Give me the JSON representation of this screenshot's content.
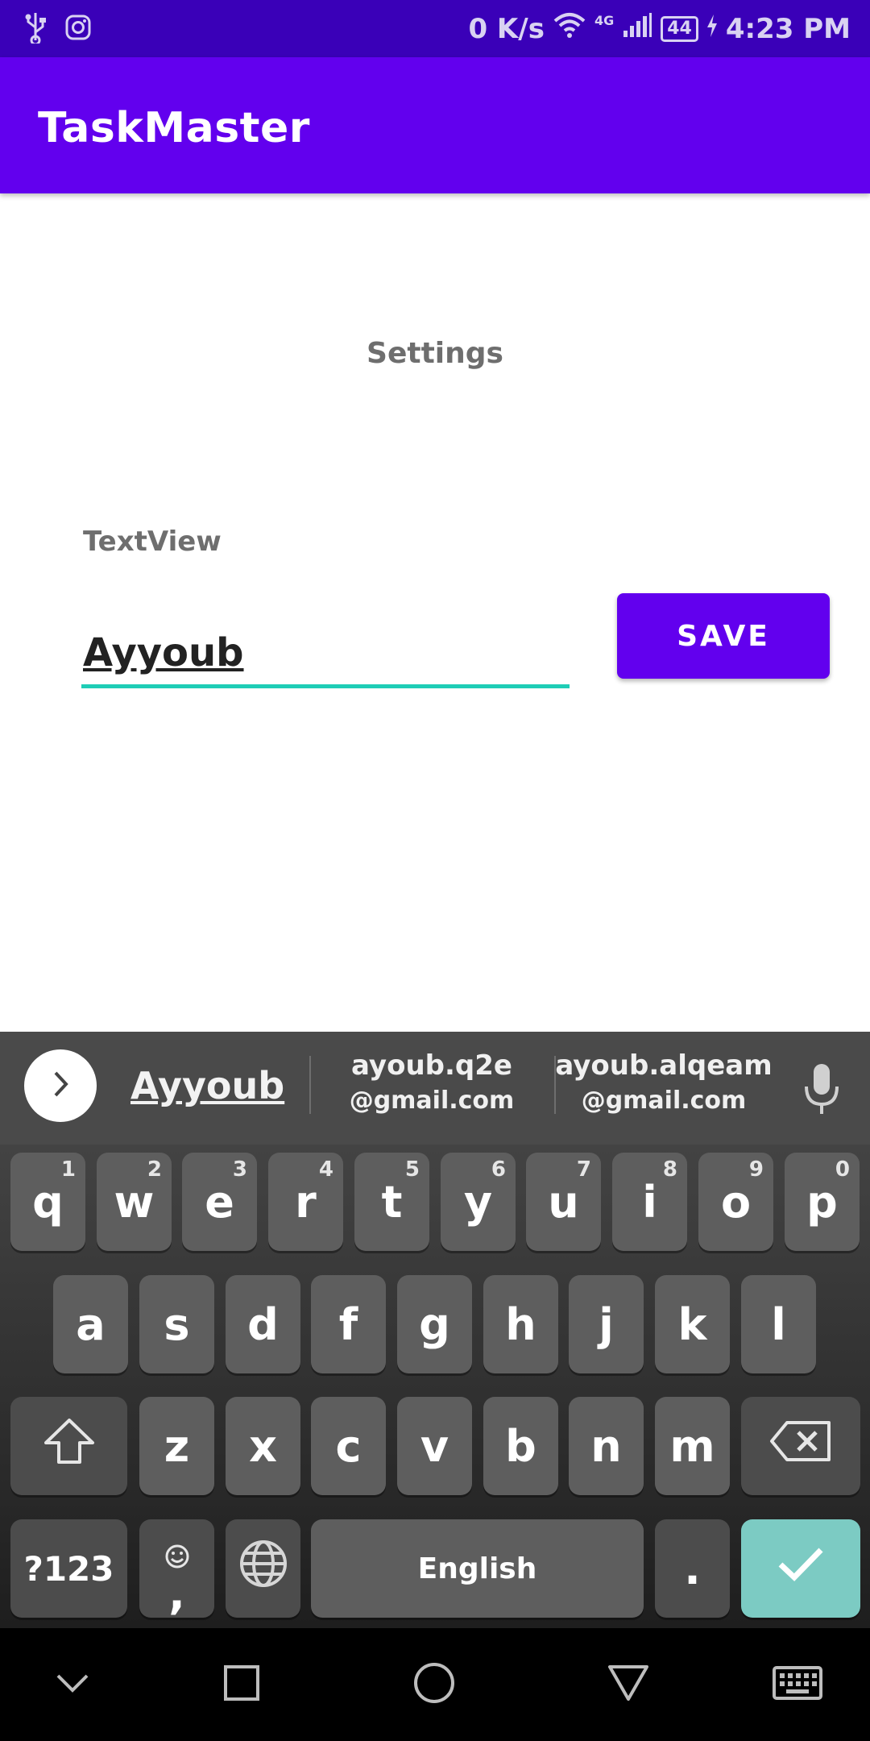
{
  "status_bar": {
    "speed": "0 K/s",
    "network": "4G",
    "battery": "44",
    "time": "4:23 PM"
  },
  "app_bar": {
    "title": "TaskMaster"
  },
  "content": {
    "settings_label": "Settings",
    "textview_label": "TextView",
    "name_value": "Ayyoub",
    "save_label": "SAVE"
  },
  "keyboard": {
    "suggestions": {
      "main": "Ayyoub",
      "second_line1": "ayoub.q2e",
      "second_line2": "@gmail.com",
      "third_line1": "ayoub.alqeam",
      "third_line2": "@gmail.com"
    },
    "row1": [
      {
        "k": "q",
        "h": "1"
      },
      {
        "k": "w",
        "h": "2"
      },
      {
        "k": "e",
        "h": "3"
      },
      {
        "k": "r",
        "h": "4"
      },
      {
        "k": "t",
        "h": "5"
      },
      {
        "k": "y",
        "h": "6"
      },
      {
        "k": "u",
        "h": "7"
      },
      {
        "k": "i",
        "h": "8"
      },
      {
        "k": "o",
        "h": "9"
      },
      {
        "k": "p",
        "h": "0"
      }
    ],
    "row2": [
      "a",
      "s",
      "d",
      "f",
      "g",
      "h",
      "j",
      "k",
      "l"
    ],
    "row3": [
      "z",
      "x",
      "c",
      "v",
      "b",
      "n",
      "m"
    ],
    "symbols_label": "?123",
    "comma_label": ",",
    "space_label": "English",
    "period_label": "."
  },
  "colors": {
    "status_bar": "#3a00b8",
    "app_bar": "#6200ee",
    "accent_underline": "#1fcdb6",
    "enter_key": "#7ccbc3"
  }
}
